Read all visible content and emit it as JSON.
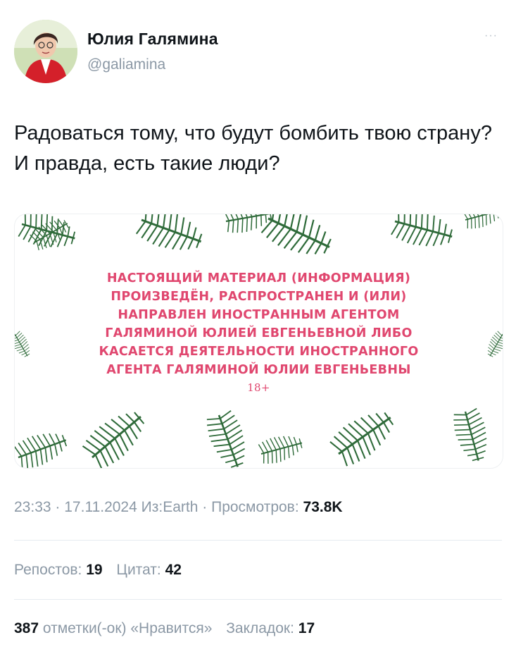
{
  "author": {
    "name": "Юлия Галямина",
    "handle": "@galiamina",
    "more": "···"
  },
  "tweet": {
    "text": "Радоваться тому, что будут бомбить твою страну? И правда, есть такие люди?"
  },
  "media": {
    "notice_lines": [
      "НАСТОЯЩИЙ МАТЕРИАЛ (ИНФОРМАЦИЯ)",
      "ПРОИЗВЕДЁН, РАСПРОСТРАНЕН И (ИЛИ)",
      "НАПРАВЛЕН ИНОСТРАННЫМ АГЕНТОМ",
      "ГАЛЯМИНОЙ ЮЛИЕЙ ЕВГЕНЬЕВНОЙ ЛИБО",
      "КАСАЕТСЯ ДЕЯТЕЛЬНОСТИ ИНОСТРАННОГО",
      "АГЕНТА ГАЛЯМИНОЙ ЮЛИИ ЕВГЕНЬЕВНЫ"
    ],
    "age_rating": "18+",
    "notice_color": "#e0476f",
    "decoration": "pine branches"
  },
  "meta": {
    "time": "23:33",
    "date": "17.11.2024",
    "source_prefix": "Из:",
    "source": "Earth",
    "views_label": "Просмотров:",
    "views": "73.8K",
    "separator": "·"
  },
  "stats": {
    "reposts_count": "19",
    "reposts_label": "Репостов:",
    "quotes_count": "42",
    "quotes_label": "Цитат:",
    "likes_count": "387",
    "likes_label": "отметки(-ок) «Нравится»",
    "bookmarks_label": "Закладок:",
    "bookmarks_count": "17"
  },
  "colors": {
    "text": "#0f1419",
    "secondary": "#8b98a5",
    "divider": "#e6ecf0",
    "pine": "#2f6b3a"
  }
}
